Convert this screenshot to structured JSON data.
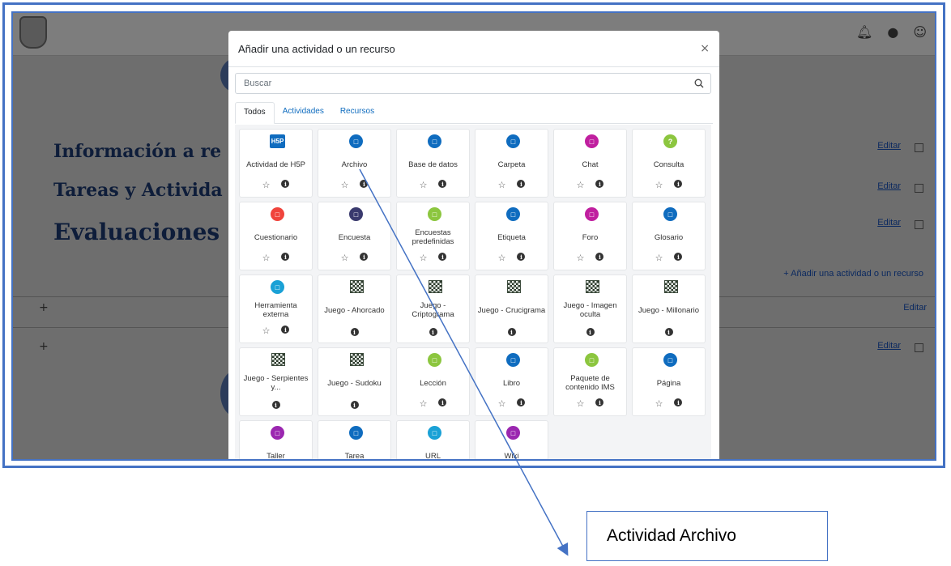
{
  "background": {
    "headings": [
      "Información a re",
      "Tareas y Activida",
      "Evaluaciones"
    ],
    "editar_label": "Editar",
    "add_resource_label": "Añadir una actividad o un recurso"
  },
  "modal": {
    "title": "Añadir una actividad o un recurso",
    "close_label": "×",
    "search_placeholder": "Buscar",
    "tabs": [
      "Todos",
      "Actividades",
      "Recursos"
    ],
    "active_tab": "Todos",
    "items": [
      {
        "label": "Actividad de H5P",
        "icon": "h5p-icon",
        "color": "#0f6cbf",
        "starred": true
      },
      {
        "label": "Archivo",
        "icon": "file-icon",
        "color": "#0f6cbf",
        "starred": true
      },
      {
        "label": "Base de datos",
        "icon": "database-icon",
        "color": "#0f6cbf",
        "starred": true
      },
      {
        "label": "Carpeta",
        "icon": "folder-icon",
        "color": "#0f6cbf",
        "starred": true
      },
      {
        "label": "Chat",
        "icon": "chat-icon",
        "color": "#c01f9f",
        "starred": true
      },
      {
        "label": "Consulta",
        "icon": "question-icon",
        "color": "#8cc63f",
        "starred": true
      },
      {
        "label": "Cuestionario",
        "icon": "quiz-icon",
        "color": "#f0443c",
        "starred": true
      },
      {
        "label": "Encuesta",
        "icon": "survey-icon",
        "color": "#3a3a6e",
        "starred": true
      },
      {
        "label": "Encuestas predefinidas",
        "icon": "feedback-icon",
        "color": "#8cc63f",
        "starred": true
      },
      {
        "label": "Etiqueta",
        "icon": "tag-icon",
        "color": "#0f6cbf",
        "starred": true
      },
      {
        "label": "Foro",
        "icon": "forum-icon",
        "color": "#c01f9f",
        "starred": true
      },
      {
        "label": "Glosario",
        "icon": "glossary-icon",
        "color": "#0f6cbf",
        "starred": true
      },
      {
        "label": "Herramienta externa",
        "icon": "external-tool-icon",
        "color": "#1aa1d6",
        "starred": true
      },
      {
        "label": "Juego - Ahorcado",
        "icon": "chessboard-icon",
        "color": "#2d3a2d",
        "starred": false
      },
      {
        "label": "Juego - Criptograma",
        "icon": "chessboard-icon",
        "color": "#2d3a2d",
        "starred": false
      },
      {
        "label": "Juego - Crucigrama",
        "icon": "chessboard-icon",
        "color": "#2d3a2d",
        "starred": false
      },
      {
        "label": "Juego - Imagen oculta",
        "icon": "chessboard-icon",
        "color": "#2d3a2d",
        "starred": false
      },
      {
        "label": "Juego - Millonario",
        "icon": "chessboard-icon",
        "color": "#2d3a2d",
        "starred": false
      },
      {
        "label": "Juego - Serpientes y...",
        "icon": "chessboard-icon",
        "color": "#2d3a2d",
        "starred": false
      },
      {
        "label": "Juego - Sudoku",
        "icon": "chessboard-icon",
        "color": "#2d3a2d",
        "starred": false
      },
      {
        "label": "Lección",
        "icon": "lesson-icon",
        "color": "#8cc63f",
        "starred": true
      },
      {
        "label": "Libro",
        "icon": "book-icon",
        "color": "#0f6cbf",
        "starred": true
      },
      {
        "label": "Paquete de contenido IMS",
        "icon": "ims-package-icon",
        "color": "#8cc63f",
        "starred": true
      },
      {
        "label": "Página",
        "icon": "page-icon",
        "color": "#0f6cbf",
        "starred": true
      },
      {
        "label": "Taller",
        "icon": "workshop-icon",
        "color": "#9b27b0",
        "starred": true
      },
      {
        "label": "Tarea",
        "icon": "assignment-icon",
        "color": "#0f6cbf",
        "starred": true
      },
      {
        "label": "URL",
        "icon": "link-icon",
        "color": "#1aa1d6",
        "starred": true
      },
      {
        "label": "Wiki",
        "icon": "wiki-icon",
        "color": "#9b27b0",
        "starred": true
      }
    ]
  },
  "callout": {
    "text": "Actividad Archivo"
  }
}
